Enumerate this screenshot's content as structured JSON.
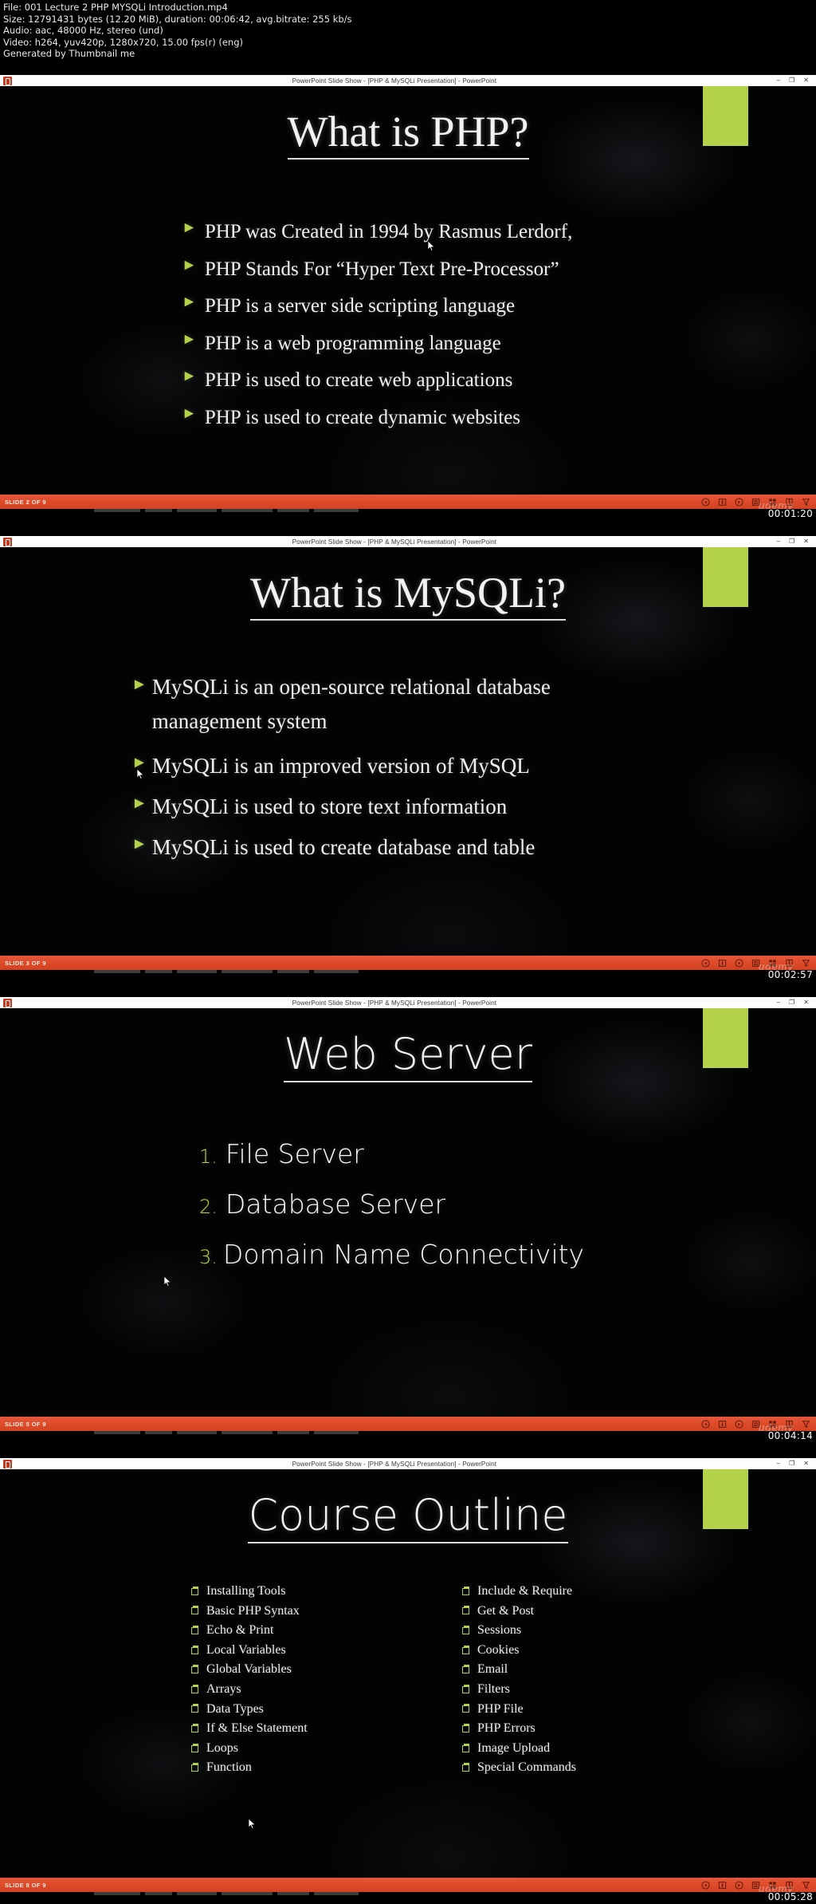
{
  "fileinfo": {
    "lines": [
      "File: 001 Lecture 2 PHP   MYSQLi Introduction.mp4",
      "Size: 12791431 bytes (12.20 MiB), duration: 00:06:42, avg.bitrate: 255 kb/s",
      "Audio: aac, 48000 Hz, stereo (und)",
      "Video: h264, yuv420p, 1280x720, 15.00 fps(r) (eng)",
      "Generated by Thumbnail me"
    ]
  },
  "window": {
    "title": "PowerPoint Slide Show - [PHP & MySQLi Presentation] - PowerPoint",
    "minimize": "–",
    "restore": "❐",
    "close": "✕",
    "logo_icon": "powerpoint-icon"
  },
  "theme": {
    "accent_green": "#b3d24a",
    "status_orange": "#e04f2e",
    "slide_bg": "#030303",
    "text": "#f0f0f0"
  },
  "watermark": "udemy",
  "statusbar_icons": [
    "previous-icon",
    "pause-icon",
    "next-icon",
    "pen-icon",
    "grid-icon",
    "zoom-icon",
    "more-options-icon"
  ],
  "slides": [
    {
      "id": "slide-php",
      "title": "What is PHP?",
      "counter": "SLIDE 2 OF 9",
      "timestamp": "00:01:20",
      "list_type": "triangle",
      "items": [
        "PHP was Created in 1994 by Rasmus Lerdorf,",
        "PHP Stands For “Hyper Text Pre-Processor”",
        "PHP is a server side scripting language",
        "PHP is a web programming language",
        "PHP is used to create web applications",
        "PHP is used to create dynamic websites"
      ]
    },
    {
      "id": "slide-mysqli",
      "title": "What is MySQLi?",
      "counter": "SLIDE 3 OF 9",
      "timestamp": "00:02:57",
      "list_type": "triangle",
      "items": [
        "MySQLi is an open-source relational database management system",
        "MySQLi is an improved version of MySQL",
        "MySQLi is used to store text information",
        "MySQLi is used to create database and table"
      ]
    },
    {
      "id": "slide-webserver",
      "title": "Web Server",
      "counter": "SLIDE 5 OF 9",
      "timestamp": "00:04:14",
      "list_type": "numbered",
      "items": [
        "File Server",
        "Database Server",
        "Domain Name Connectivity"
      ]
    },
    {
      "id": "slide-outline",
      "title": "Course Outline",
      "counter": "SLIDE 8 OF 9",
      "timestamp": "00:05:28",
      "list_type": "checkbox-two-column",
      "column_left": [
        "Installing Tools",
        "Basic PHP Syntax",
        "Echo & Print",
        "Local Variables",
        "Global Variables",
        "Arrays",
        "Data Types",
        "If & Else Statement",
        "Loops",
        "Function"
      ],
      "column_right": [
        "Include & Require",
        "Get & Post",
        "Sessions",
        "Cookies",
        "Email",
        "Filters",
        "PHP File",
        "PHP Errors",
        "Image Upload",
        "Special Commands"
      ]
    }
  ]
}
